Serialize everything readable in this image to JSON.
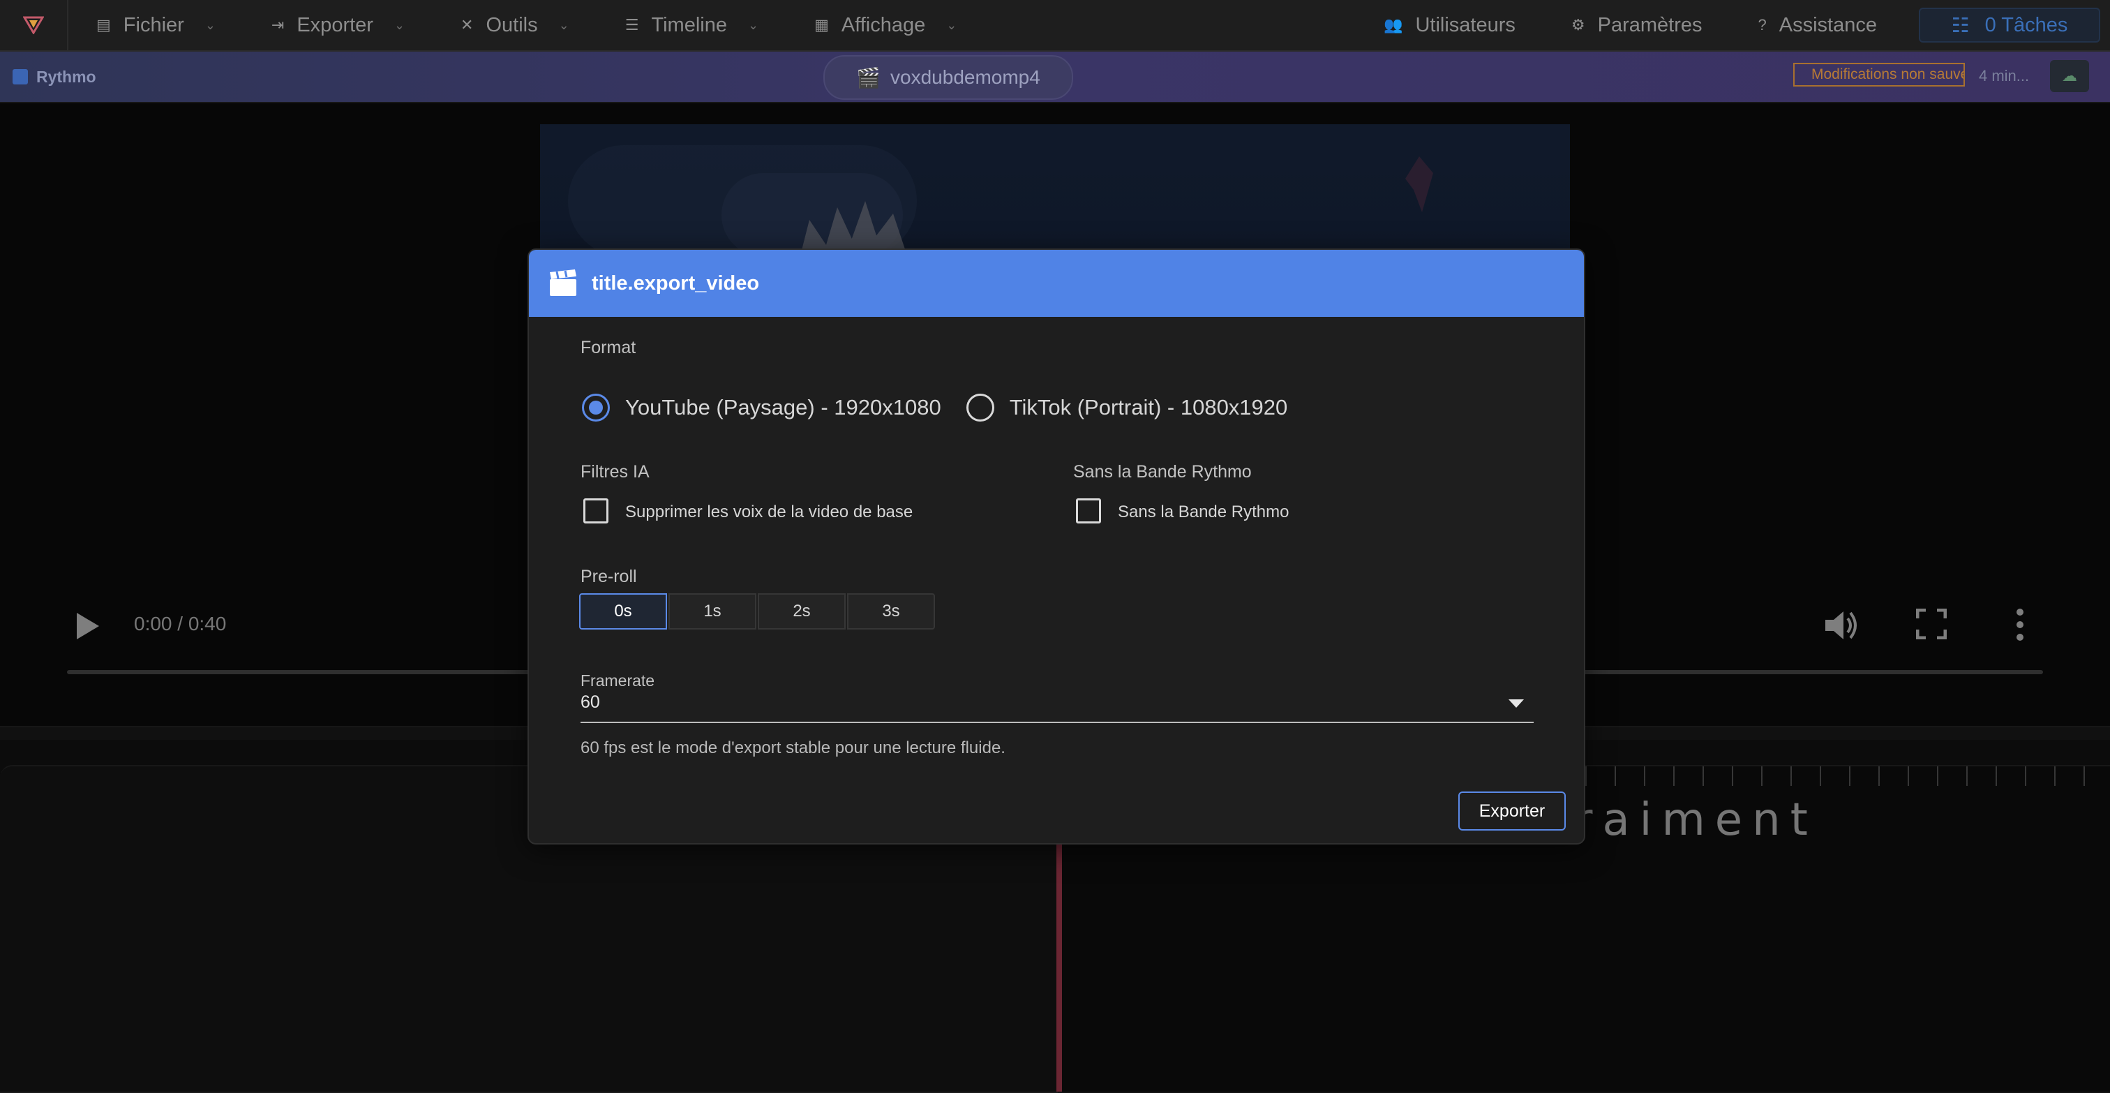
{
  "menubar": {
    "items": [
      {
        "label": "Fichier",
        "icon": "file-icon"
      },
      {
        "label": "Exporter",
        "icon": "export-icon"
      },
      {
        "label": "Outils",
        "icon": "tools-icon"
      },
      {
        "label": "Timeline",
        "icon": "timeline-icon"
      },
      {
        "label": "Affichage",
        "icon": "grid-icon"
      }
    ],
    "right": [
      {
        "label": "Utilisateurs",
        "icon": "users-icon"
      },
      {
        "label": "Paramètres",
        "icon": "gear-icon"
      },
      {
        "label": "Assistance",
        "icon": "help-icon"
      }
    ],
    "tasks_label": "0 Tâches"
  },
  "projectbar": {
    "brand": "Rythmo",
    "project_name": "voxdubdemomp4",
    "unsaved": "Modifications non sauvegardées",
    "time_ago": "4 min..."
  },
  "player": {
    "time": "0:00 / 0:40",
    "progress": 0
  },
  "rythmo": {
    "text": "C'est ça tu es vraiment"
  },
  "modal": {
    "title": "title.export_video",
    "format_label": "Format",
    "format_options": [
      "YouTube (Paysage) - 1920x1080",
      "TikTok (Portrait) - 1080x1920"
    ],
    "format_selected": "YouTube (Paysage) - 1920x1080",
    "ai_filters_label": "Filtres IA",
    "ai_filter_option": "Supprimer les voix de la video de base",
    "no_band_label": "Sans la Bande Rythmo",
    "no_band_option": "Sans la Bande Rythmo",
    "preroll_label": "Pre-roll",
    "preroll_options": [
      "0s",
      "1s",
      "2s",
      "3s"
    ],
    "preroll_selected": "0s",
    "framerate_label": "Framerate",
    "framerate_value": "60",
    "framerate_hint": "60 fps est le mode d'export stable pour une lecture fluide.",
    "export_button": "Exporter"
  },
  "colors": {
    "accent": "#5083e6",
    "playhead": "#c4465d",
    "warning": "#b77a36"
  }
}
